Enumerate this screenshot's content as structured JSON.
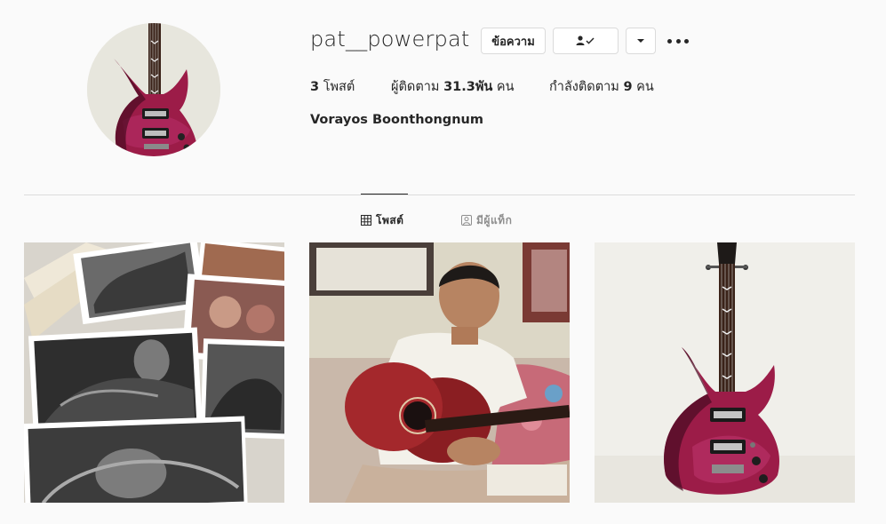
{
  "profile": {
    "username": "pat__powerpat",
    "full_name": "Vorayos Boonthongnum",
    "avatar": "electric-guitar-photo"
  },
  "actions": {
    "message_label": "ข้อความ",
    "follow_icon": "person-check-icon",
    "dropdown_icon": "caret-down-icon",
    "more_icon": "more-horizontal-icon"
  },
  "stats": {
    "posts_count": "3",
    "posts_label": " โพสต์",
    "followers_prefix": "ผู้ติดตาม ",
    "followers_count": "31.3พัน",
    "followers_suffix": " คน",
    "following_prefix": "กำลังติดตาม ",
    "following_count": "9",
    "following_suffix": " คน"
  },
  "tabs": [
    {
      "label": "โพสต์",
      "icon": "grid-icon",
      "active": true
    },
    {
      "label": "มีผู้แท็ก",
      "icon": "tagged-icon",
      "active": false
    }
  ],
  "posts": [
    {
      "subject": "tattoo-drawings-photo"
    },
    {
      "subject": "boy-with-acoustic-guitar-photo"
    },
    {
      "subject": "electric-guitar-photo"
    }
  ],
  "colors": {
    "background": "#fafafa",
    "text": "#262626",
    "muted": "#8e8e8e",
    "border": "#dbdbdb",
    "guitar_body": "#a0204c"
  }
}
